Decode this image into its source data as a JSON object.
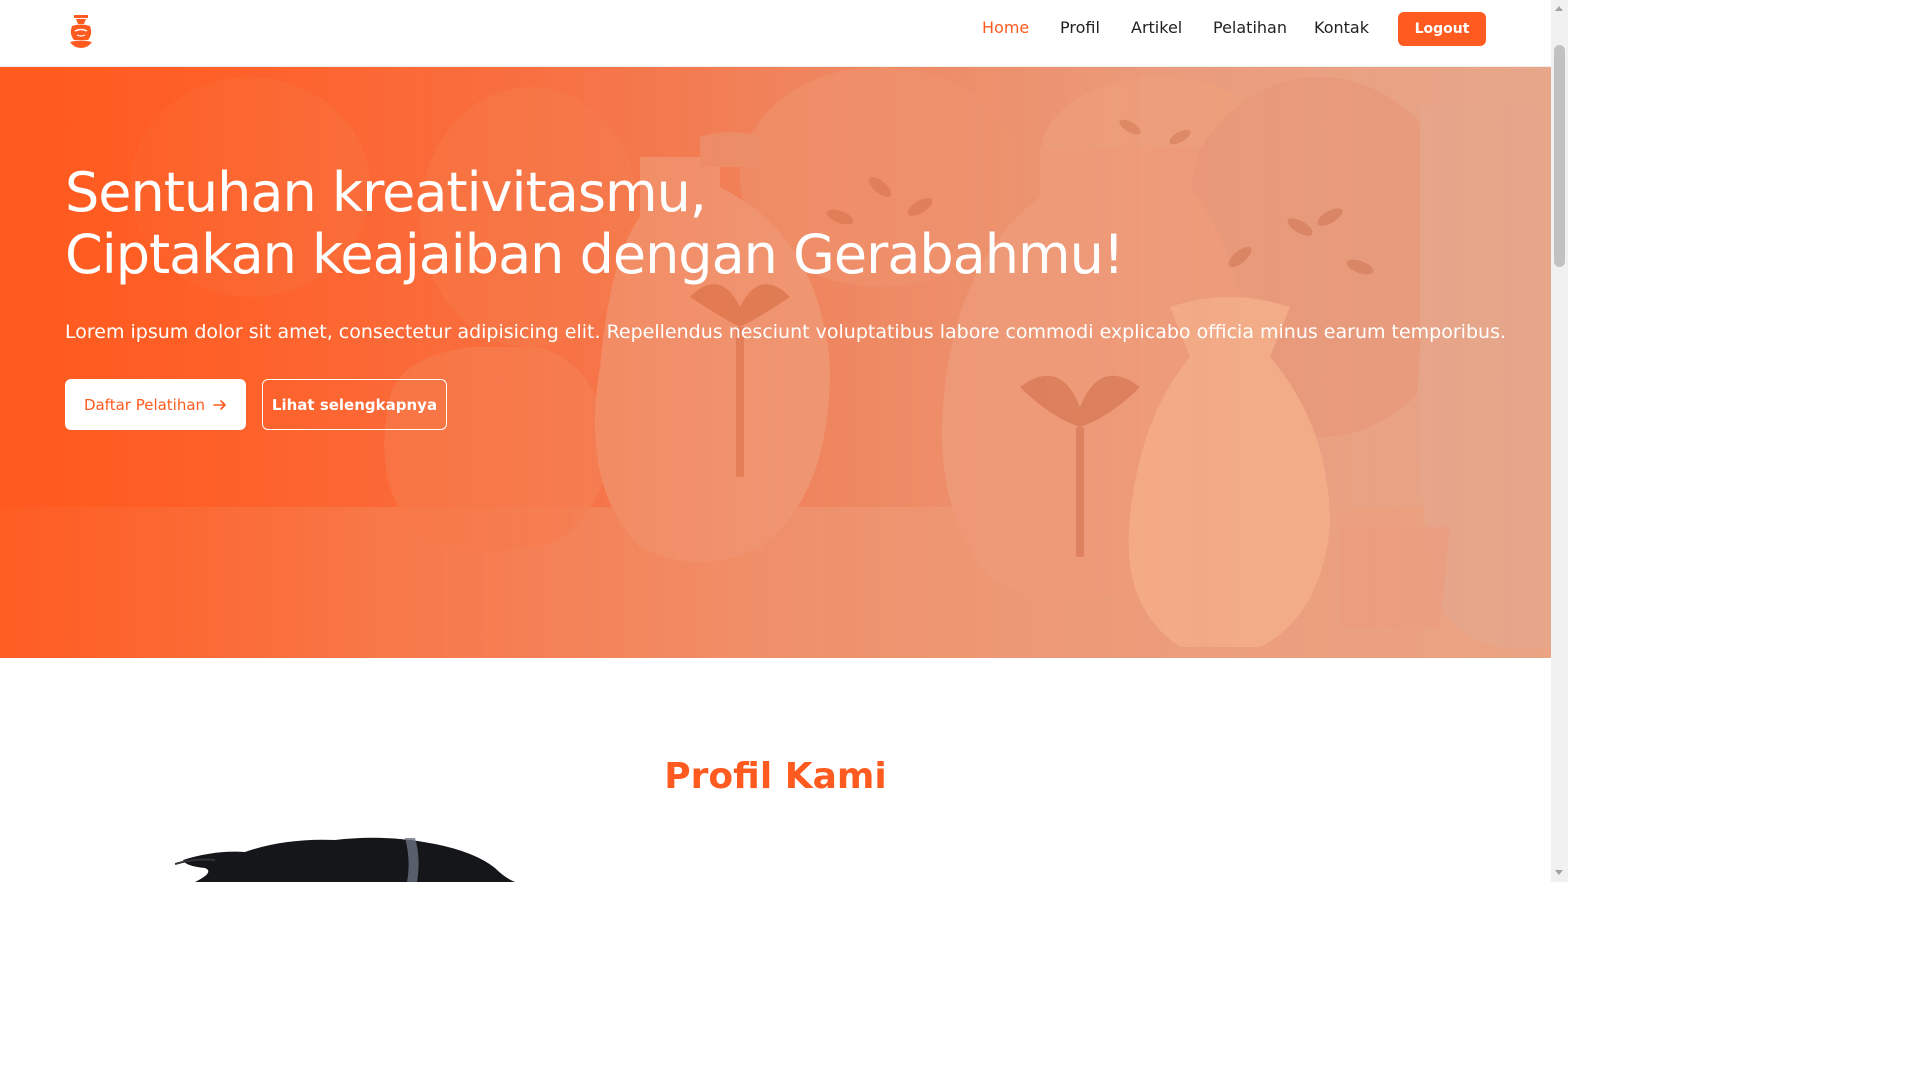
{
  "colors": {
    "accent": "#ff5a1f",
    "white": "#ffffff",
    "text": "#222222"
  },
  "navbar": {
    "logo_icon": "pottery-logo-icon",
    "links": [
      {
        "label": "Home",
        "active": true
      },
      {
        "label": "Profil",
        "active": false
      },
      {
        "label": "Artikel",
        "active": false
      },
      {
        "label": "Pelatihan",
        "active": false
      },
      {
        "label": "Kontak",
        "active": false
      }
    ],
    "logout_label": "Logout"
  },
  "hero": {
    "title_line1": "Sentuhan kreativitasmu,",
    "title_line2": "Ciptakan keajaiban dengan Gerabahmu!",
    "subtitle": "Lorem ipsum dolor sit amet, consectetur adipisicing elit. Repellendus nesciunt voluptatibus labore commodi explicabo officia minus earum temporibus.",
    "primary_button": "Daftar Pelatihan",
    "primary_button_icon": "arrow-right-icon",
    "secondary_button": "Lihat selengkapnya",
    "background_image": "terracotta-pottery-vases-photo"
  },
  "profile_section": {
    "title": "Profil Kami",
    "image": "profile-photo-dark-brush"
  }
}
